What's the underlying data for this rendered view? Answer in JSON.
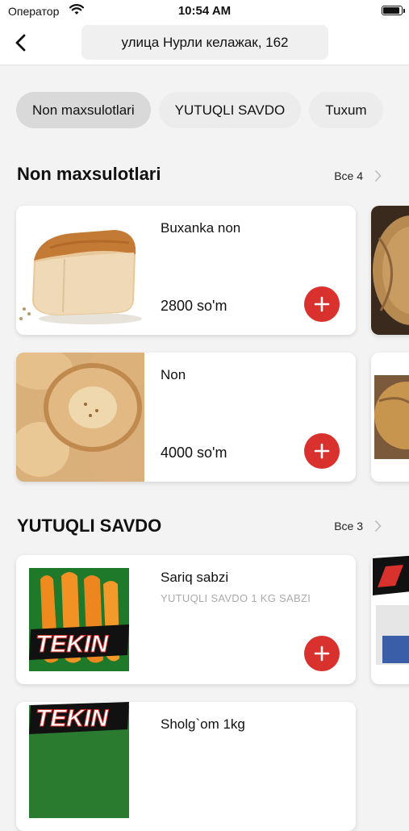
{
  "status_bar": {
    "carrier": "Оператор",
    "time": "10:54 AM"
  },
  "header": {
    "address": "улица Нурли келажак, 162"
  },
  "categories": [
    {
      "label": "Non maxsulotlari"
    },
    {
      "label": "YUTUQLI SAVDO"
    },
    {
      "label": "Tuxum"
    }
  ],
  "sections": [
    {
      "title": "Non maxsulotlari",
      "see_all": "Все 4",
      "products": [
        {
          "name": "Buxanka non",
          "price": "2800 so'm"
        },
        {
          "name": "Non",
          "price": "4000 so'm"
        }
      ]
    },
    {
      "title": "YUTUQLI SAVDO",
      "see_all": "Все 3",
      "products": [
        {
          "name": "Sariq sabzi",
          "description": "YUTUQLI SAVDO 1 KG SABZI",
          "brand": "TEKIN"
        },
        {
          "name": "Sholg`om 1kg",
          "brand": "TEKIN"
        }
      ]
    }
  ],
  "colors": {
    "accent": "#d8312e",
    "background": "#f3f3f3"
  }
}
